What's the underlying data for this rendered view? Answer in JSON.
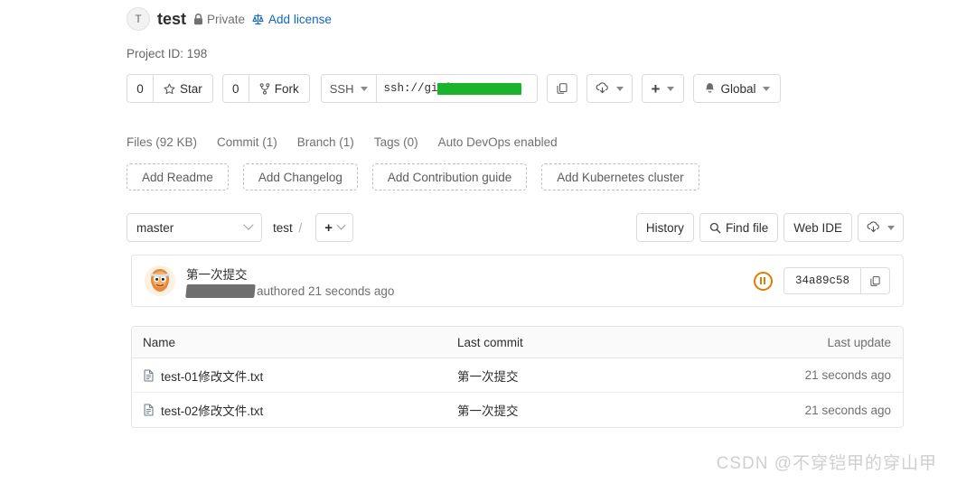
{
  "header": {
    "avatar_initial": "T",
    "project_name": "test",
    "visibility": "Private",
    "license_link": "Add license",
    "project_id": "Project ID: 198"
  },
  "action_bar": {
    "star_count": "0",
    "star_label": "Star",
    "fork_count": "0",
    "fork_label": "Fork",
    "clone_protocol": "SSH",
    "clone_url_prefix": "ssh://git@",
    "clone_url_suffix": "::",
    "notification_label": "Global"
  },
  "stats": [
    "Files (92 KB)",
    "Commit (1)",
    "Branch (1)",
    "Tags (0)",
    "Auto DevOps enabled"
  ],
  "quick_actions": [
    "Add Readme",
    "Add Changelog",
    "Add Contribution guide",
    "Add Kubernetes cluster"
  ],
  "branch_row": {
    "branch": "master",
    "breadcrumb_root": "test",
    "breadcrumb_sep": "/",
    "add_label": "+",
    "history_label": "History",
    "find_file_label": "Find file",
    "web_ide_label": "Web IDE"
  },
  "commit": {
    "title": "第一次提交",
    "authored_text": "authored 21 seconds ago",
    "sha": "34a89c58"
  },
  "file_table": {
    "columns": [
      "Name",
      "Last commit",
      "Last update"
    ],
    "rows": [
      {
        "name": "test-01修改文件.txt",
        "last_commit": "第一次提交",
        "last_update": "21 seconds ago"
      },
      {
        "name": "test-02修改文件.txt",
        "last_commit": "第一次提交",
        "last_update": "21 seconds ago"
      }
    ]
  },
  "watermark": "CSDN @不穿铠甲的穿山甲",
  "colors": {
    "link": "#1068bf",
    "redaction_green": "#19b42c",
    "redaction_gray": "#6e6e6e",
    "ci_pending": "#de7e00"
  }
}
